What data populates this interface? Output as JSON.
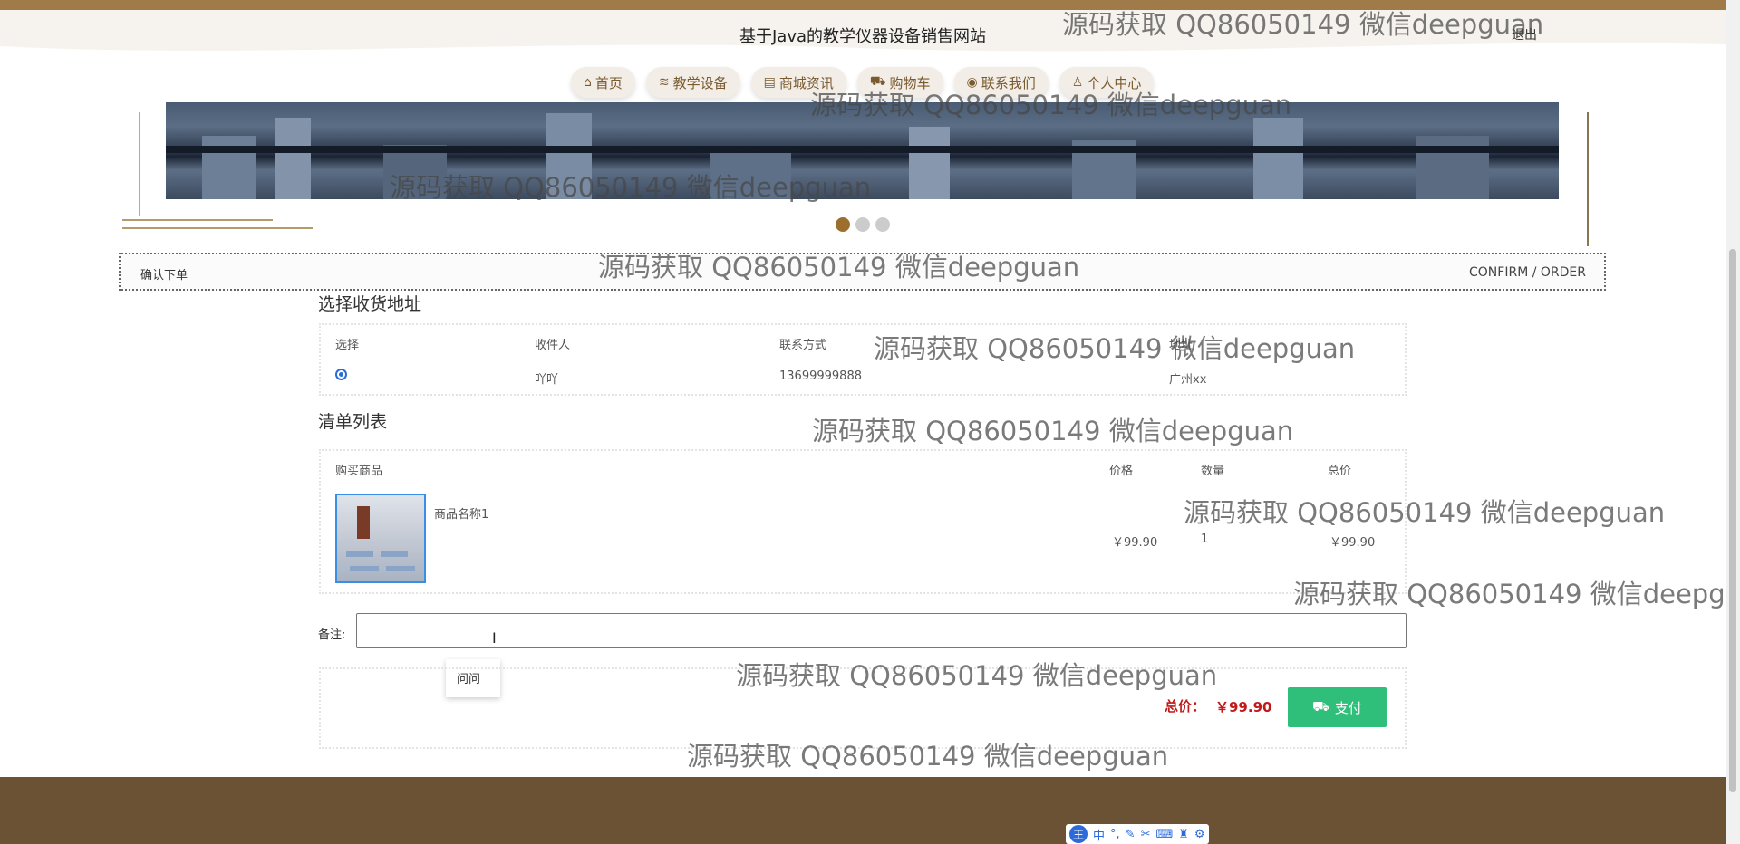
{
  "header": {
    "site_title": "基于Java的教学仪器设备销售网站",
    "logout": "退出"
  },
  "nav": [
    {
      "icon": "home-icon",
      "glyph": "⌂",
      "label": "首页"
    },
    {
      "icon": "layers-icon",
      "glyph": "≋",
      "label": "教学设备"
    },
    {
      "icon": "printer-icon",
      "glyph": "▤",
      "label": "商城资讯"
    },
    {
      "icon": "cart-icon",
      "glyph": "🛒",
      "label": "购物车"
    },
    {
      "icon": "chat-icon",
      "glyph": "●",
      "label": "联系我们"
    },
    {
      "icon": "user-icon",
      "glyph": "♙",
      "label": "个人中心"
    }
  ],
  "section": {
    "left": "确认下单",
    "right": "CONFIRM / ORDER"
  },
  "address": {
    "title": "选择收货地址",
    "headers": [
      "选择",
      "收件人",
      "联系方式",
      "地址"
    ],
    "rows": [
      {
        "selected": true,
        "recipient": "吖吖",
        "phone": "13699999888",
        "address": "广州xx"
      }
    ]
  },
  "items": {
    "title": "清单列表",
    "headers": [
      "购买商品",
      "价格",
      "数量",
      "总价"
    ],
    "rows": [
      {
        "name": "商品名称1",
        "price": "￥99.90",
        "qty": "1",
        "total": "￥99.90"
      }
    ]
  },
  "remark": {
    "label": "备注:",
    "value": "",
    "suggestion": "问问"
  },
  "summary": {
    "total_label": "总价：",
    "total_value": "￥99.90",
    "pay_label": "支付"
  },
  "watermark": "源码获取 QQ86050149 微信deepguan",
  "colors": {
    "accent": "#9c6f2e",
    "footer": "#6c5235",
    "pay": "#2fbf7a",
    "price": "#c21a1a"
  }
}
